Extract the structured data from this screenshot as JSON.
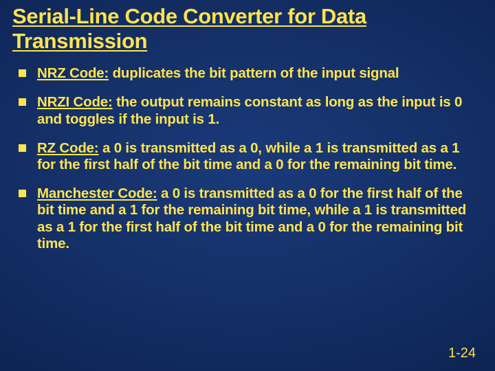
{
  "title": "Serial-Line Code Converter for Data Transmission",
  "bullets": [
    {
      "term": "NRZ Code:",
      "rest": " duplicates the bit pattern of the input signal"
    },
    {
      "term": "NRZI Code:",
      "rest": " the output remains constant as long as the input is 0 and toggles if the input is 1."
    },
    {
      "term": "RZ Code:",
      "rest": " a 0 is transmitted as a 0, while a 1 is transmitted as a 1 for the first half of the bit time and a 0 for the remaining bit time."
    },
    {
      "term": "Manchester Code:",
      "rest": " a 0 is transmitted as a 0 for the first half of the bit time and a 1 for the remaining bit time, while a 1 is transmitted as a 1 for the first half of the bit time and a 0 for the remaining bit time."
    }
  ],
  "page_number": "1-24"
}
